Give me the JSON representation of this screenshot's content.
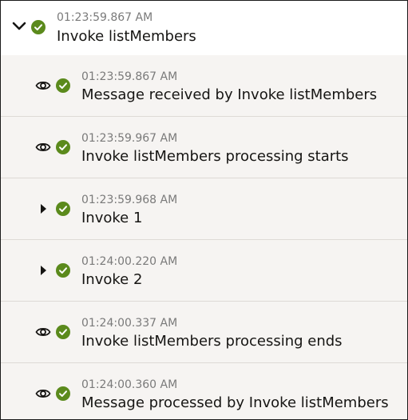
{
  "header": {
    "timestamp": "01:23:59.867 AM",
    "title": "Invoke listMembers",
    "toggle_icon": "chevron-down-icon",
    "status_icon": "success-check-icon",
    "status_color": "#5b8a1c"
  },
  "steps": [
    {
      "icon": "eye-icon",
      "timestamp": "01:23:59.867 AM",
      "label": "Message received by Invoke listMembers"
    },
    {
      "icon": "eye-icon",
      "timestamp": "01:23:59.967 AM",
      "label": "Invoke listMembers processing starts"
    },
    {
      "icon": "caret-right-icon",
      "timestamp": "01:23:59.968 AM",
      "label": "Invoke 1"
    },
    {
      "icon": "caret-right-icon",
      "timestamp": "01:24:00.220 AM",
      "label": "Invoke 2"
    },
    {
      "icon": "eye-icon",
      "timestamp": "01:24:00.337 AM",
      "label": "Invoke listMembers processing ends"
    },
    {
      "icon": "eye-icon",
      "timestamp": "01:24:00.360 AM",
      "label": "Message processed by Invoke listMembers"
    }
  ]
}
